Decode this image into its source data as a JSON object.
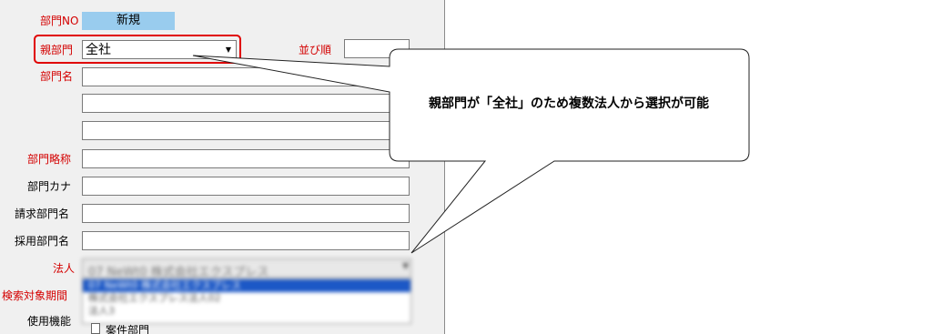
{
  "form": {
    "labels": {
      "dept_no": "部門NO",
      "parent_dept": "親部門",
      "sort_order": "並び順",
      "dept_name": "部門名",
      "dept_abbr": "部門略称",
      "dept_kana": "部門カナ",
      "billing_dept_name": "請求部門名",
      "hiring_dept_name": "採用部門名",
      "corporation": "法人",
      "search_period": "検索対象期間",
      "usage_function": "使用機能"
    },
    "dept_no_value": "新規",
    "parent_dept_value": "全社",
    "corporation_value": "07 NeWt0 株式会社エクスプレス",
    "corporation_options": [
      "07 NeWt0 株式会社エクスプレス",
      "株式会社エクスプレス法人02",
      "法人3"
    ],
    "checkbox_label": "案件部門"
  },
  "callout": {
    "text": "親部門が「全社」のため複数法人から選択が可能",
    "accent_color": "#e00000"
  }
}
